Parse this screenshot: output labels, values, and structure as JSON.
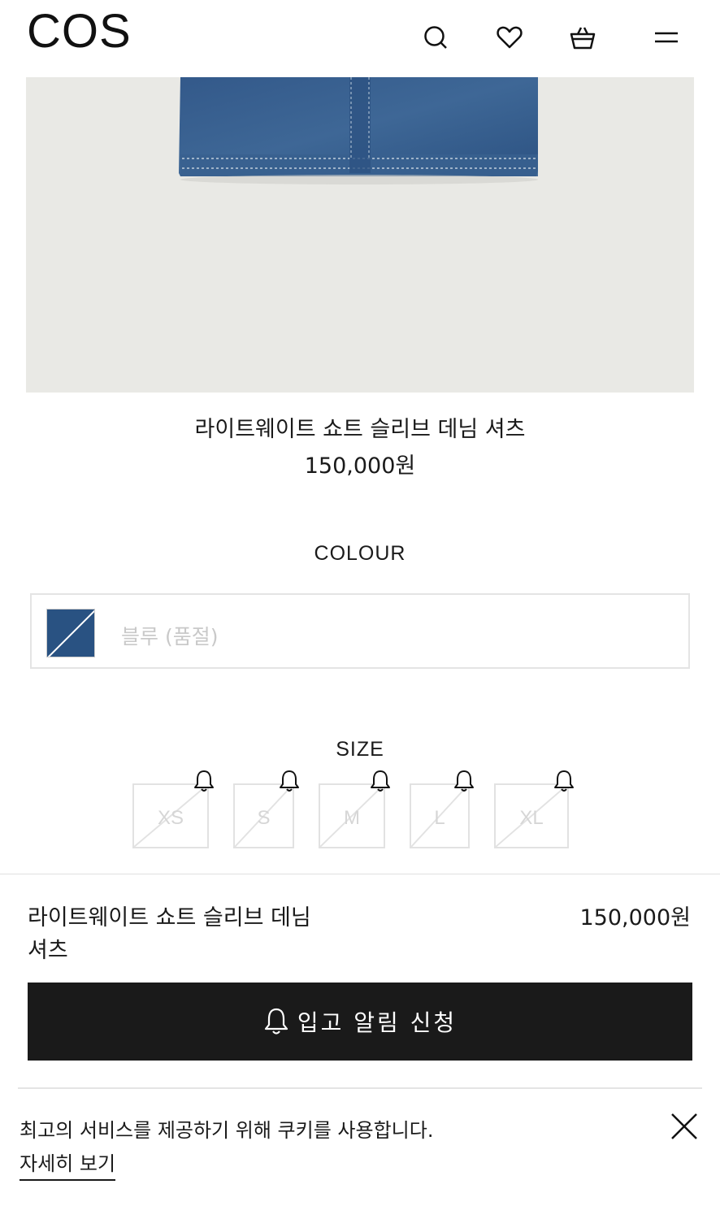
{
  "header": {
    "logo": "COS",
    "icons": [
      "search-icon",
      "heart-icon",
      "basket-icon",
      "menu-icon"
    ]
  },
  "product": {
    "title": "라이트웨이트 쇼트 슬리브 데님 셔츠",
    "price": "150,000원"
  },
  "colour": {
    "heading": "COLOUR",
    "selected": "블루 (품절)",
    "swatch_color": "#2f5b8c"
  },
  "size": {
    "heading": "SIZE",
    "options": [
      "XS",
      "S",
      "M",
      "L",
      "XL"
    ]
  },
  "sticky": {
    "title": "라이트웨이트 쇼트 슬리브 데님 셔츠",
    "price": "150,000원",
    "button_label": "입고 알림 신청"
  },
  "cookie": {
    "text": "최고의 서비스를 제공하기 위해 쿠키를 사용합니다.",
    "link": "자세히 보기"
  }
}
